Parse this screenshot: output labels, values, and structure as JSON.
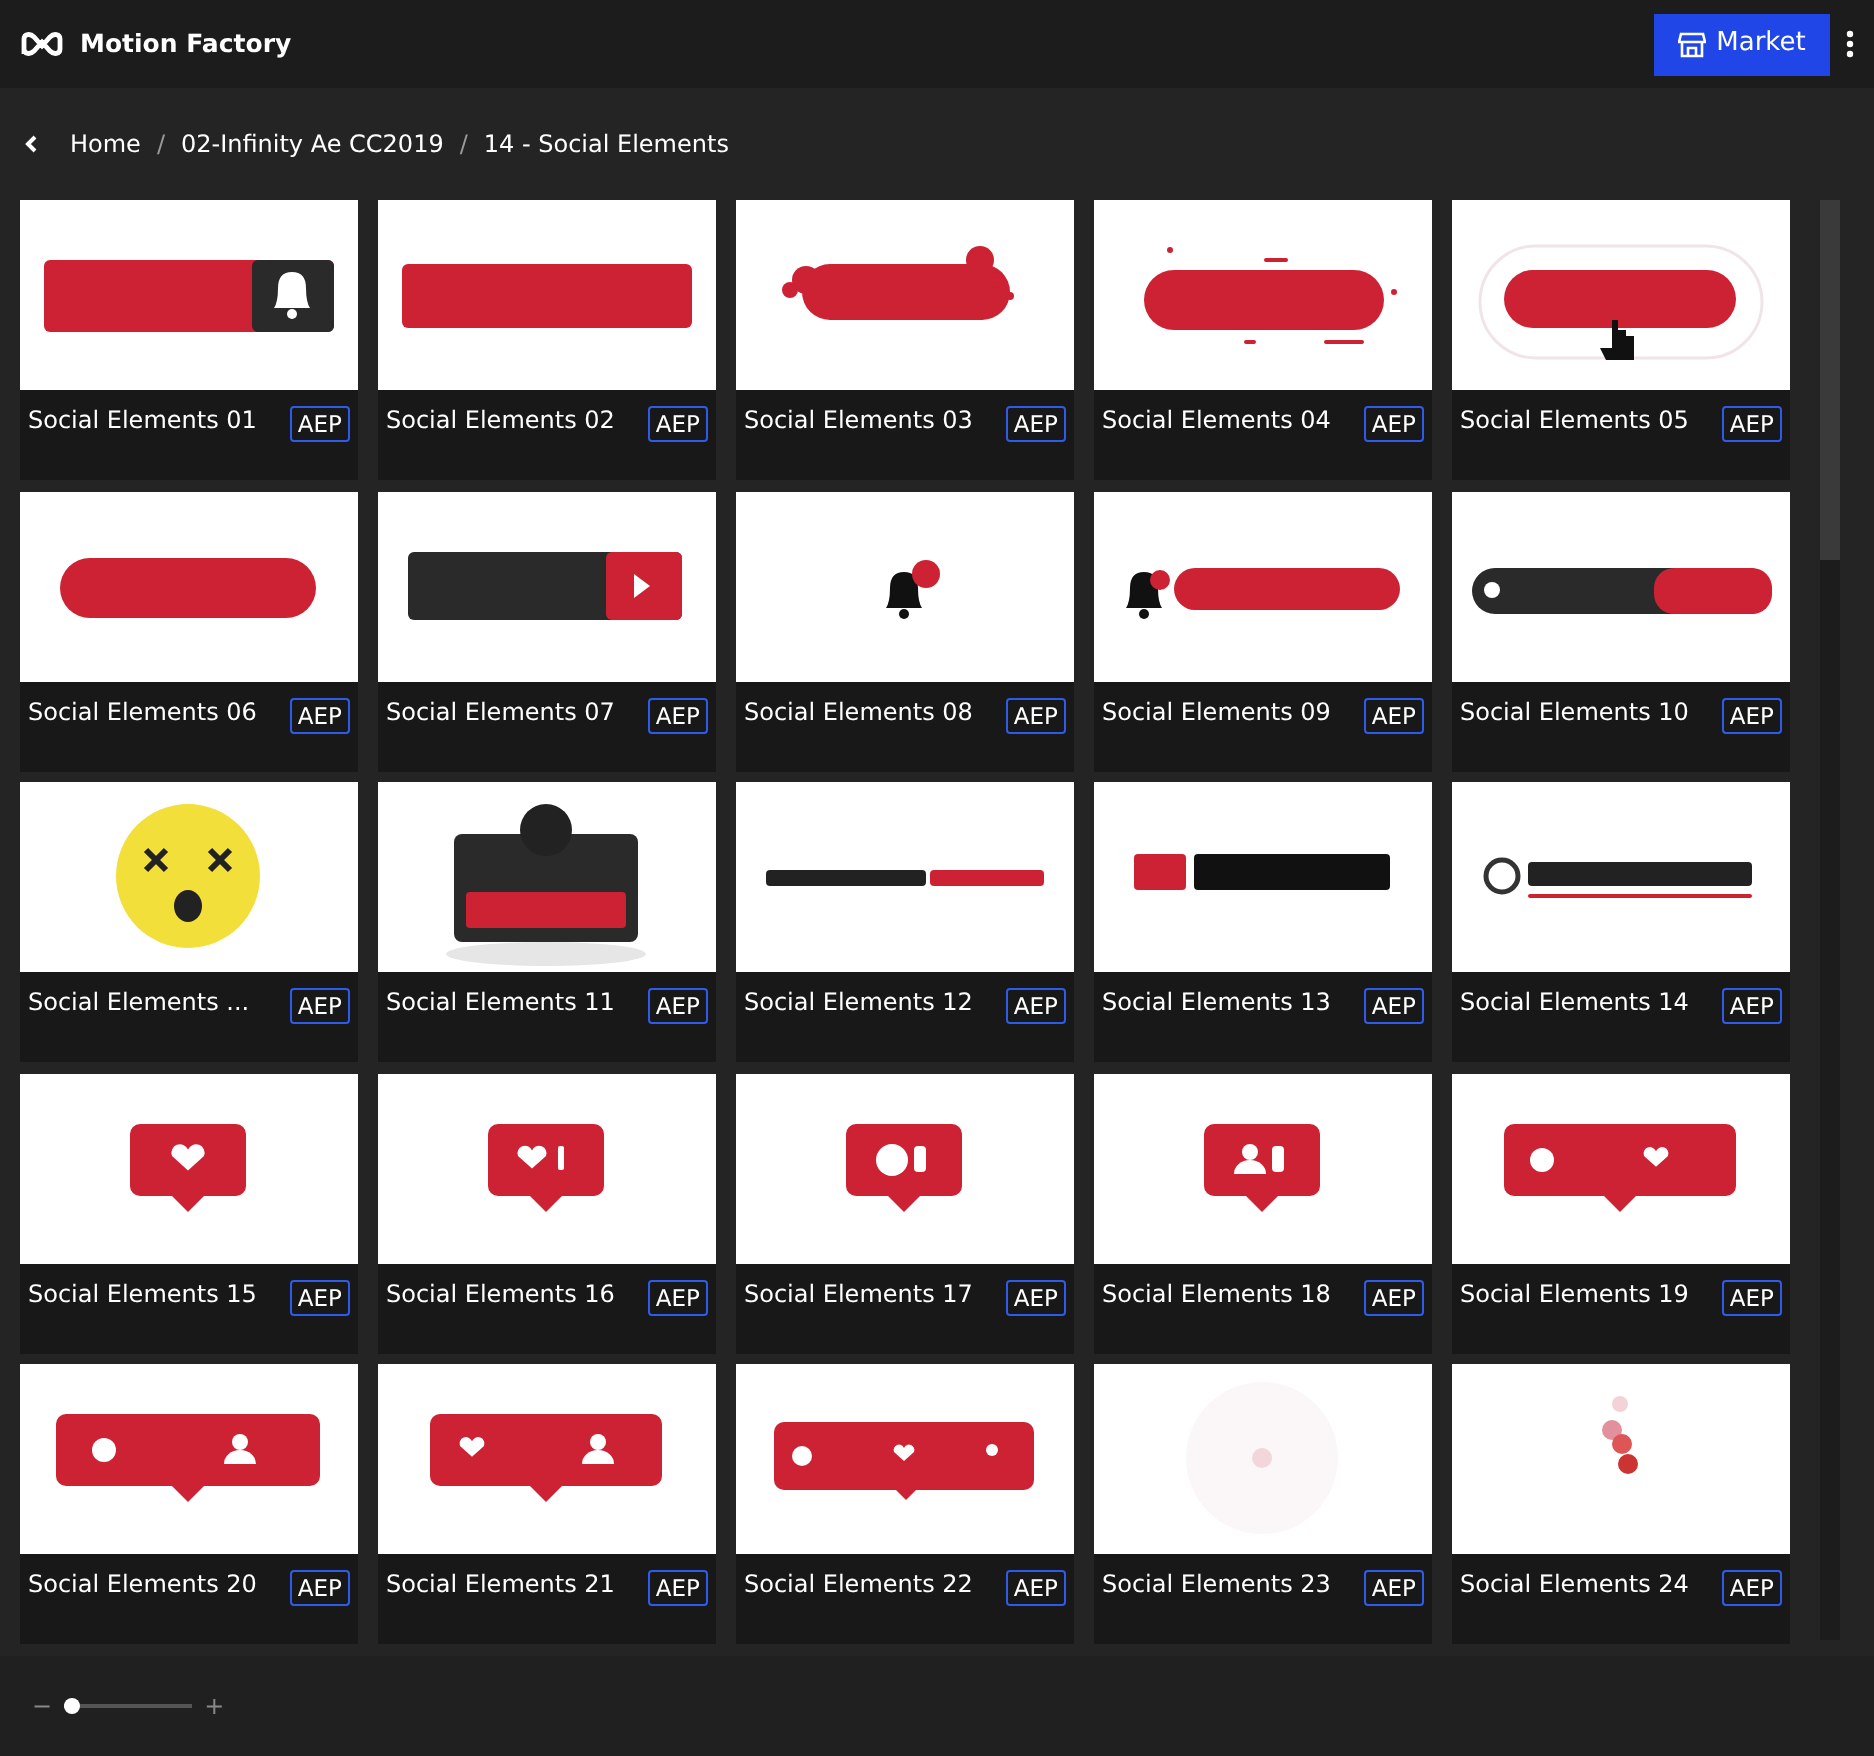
{
  "app": {
    "title": "Motion Factory",
    "market_button": "Market"
  },
  "breadcrumb": [
    {
      "label": "Home"
    },
    {
      "separator": "/",
      "label": "02-Infinity Ae CC2019"
    },
    {
      "separator": "/",
      "label": "14 - Social Elements"
    }
  ],
  "items": [
    {
      "title": "Social Elements 01",
      "badge": "AEP"
    },
    {
      "title": "Social Elements 02",
      "badge": "AEP"
    },
    {
      "title": "Social Elements 03",
      "badge": "AEP"
    },
    {
      "title": "Social Elements 04",
      "badge": "AEP"
    },
    {
      "title": "Social Elements 05",
      "badge": "AEP"
    },
    {
      "title": "Social Elements 06",
      "badge": "AEP"
    },
    {
      "title": "Social Elements 07",
      "badge": "AEP"
    },
    {
      "title": "Social Elements 08",
      "badge": "AEP"
    },
    {
      "title": "Social Elements 09",
      "badge": "AEP"
    },
    {
      "title": "Social Elements 10",
      "badge": "AEP"
    },
    {
      "title": "Social Elements ...",
      "badge": "AEP"
    },
    {
      "title": "Social Elements 11",
      "badge": "AEP"
    },
    {
      "title": "Social Elements 12",
      "badge": "AEP"
    },
    {
      "title": "Social Elements 13",
      "badge": "AEP"
    },
    {
      "title": "Social Elements 14",
      "badge": "AEP"
    },
    {
      "title": "Social Elements 15",
      "badge": "AEP"
    },
    {
      "title": "Social Elements 16",
      "badge": "AEP"
    },
    {
      "title": "Social Elements 17",
      "badge": "AEP"
    },
    {
      "title": "Social Elements 18",
      "badge": "AEP"
    },
    {
      "title": "Social Elements 19",
      "badge": "AEP"
    },
    {
      "title": "Social Elements 20",
      "badge": "AEP"
    },
    {
      "title": "Social Elements 21",
      "badge": "AEP"
    },
    {
      "title": "Social Elements 22",
      "badge": "AEP"
    },
    {
      "title": "Social Elements 23",
      "badge": "AEP"
    },
    {
      "title": "Social Elements 24",
      "badge": "AEP"
    }
  ],
  "zoom": {
    "minus": "−",
    "plus": "+",
    "level": 0.06
  }
}
